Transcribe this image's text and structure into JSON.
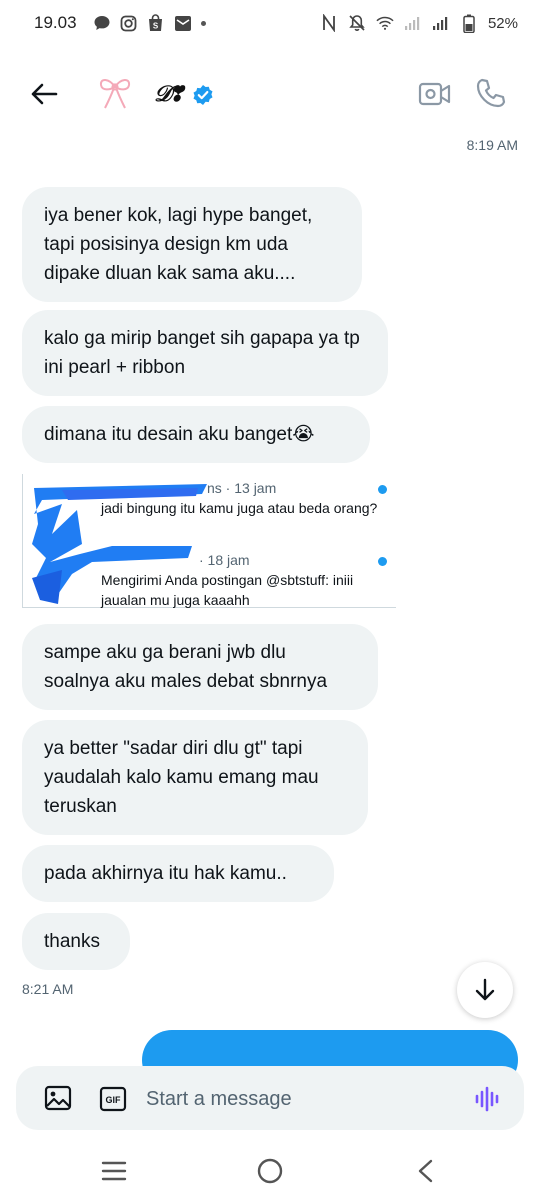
{
  "status_bar": {
    "time": "19.03",
    "battery": "52%",
    "icons": [
      "chat-icon",
      "instagram-icon",
      "shop-icon",
      "mail-icon",
      "nfc-icon",
      "mute-icon",
      "wifi-icon",
      "signal-icon",
      "battery-icon"
    ]
  },
  "header": {
    "display_name": "𝒟❣",
    "verified": true
  },
  "conversation": {
    "timestamp_top": "8:19 AM",
    "messages": [
      {
        "text": "iya bener kok, lagi hype banget, tapi posisinya design km uda dipake dluan kak sama aku...."
      },
      {
        "text": "kalo ga mirip banget sih gapapa ya tp ini pearl + ribbon"
      },
      {
        "text": "dimana itu desain aku banget😭"
      },
      {
        "text": "sampe aku ga berani jwb dlu soalnya aku males debat sbnrnya"
      },
      {
        "text": "ya better \"sadar diri dlu gt\" tapi yaudalah kalo kamu emang mau teruskan"
      },
      {
        "text": "pada akhirnya itu hak kamu.."
      },
      {
        "text": "thanks"
      }
    ],
    "quoted": [
      {
        "meta": "ns · 13 jam",
        "text": "jadi bingung itu kamu juga atau beda orang?"
      },
      {
        "meta": "· 18 jam",
        "text": "Mengirimi Anda postingan @sbtstuff: iniii jaualan mu juga kaaahh"
      }
    ],
    "timestamp_bottom": "8:21 AM"
  },
  "composer": {
    "placeholder": "Start a message",
    "gif_label": "GIF"
  },
  "colors": {
    "accent": "#1d9bf0",
    "bubble": "#eff3f4",
    "voice": "#7856ff",
    "bow": "#f4a9b8"
  }
}
